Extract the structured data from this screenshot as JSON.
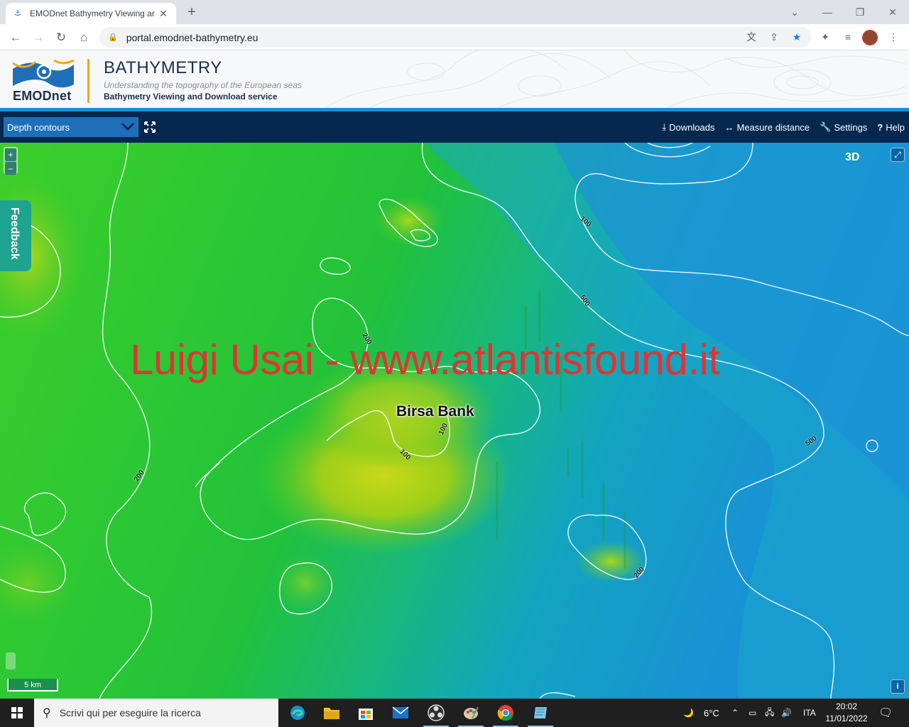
{
  "browser": {
    "tab_title": "EMODnet Bathymetry Viewing ar",
    "url": "portal.emodnet-bathymetry.eu"
  },
  "header": {
    "logo_text": "EMODnet",
    "title": "BATHYMETRY",
    "subtitle": "Understanding the topography of the European seas",
    "service": "Bathymetry Viewing and Download service"
  },
  "nav": {
    "layer_selected": "Depth contours",
    "downloads": "Downloads",
    "measure": "Measure distance",
    "settings": "Settings",
    "help": "Help"
  },
  "map": {
    "feedback": "Feedback",
    "btn_3d": "3D",
    "zoom_in": "+",
    "zoom_out": "–",
    "scale": "5 km",
    "info": "i",
    "watermark": "Luigi Usai - www.atlantisfound.it",
    "place_label": "Birsa Bank",
    "contour_labels": {
      "c1": "100",
      "c2": "500",
      "c3": "200",
      "c4": "100",
      "c5": "100",
      "c6": "500",
      "c7": "200",
      "c8": "200"
    }
  },
  "taskbar": {
    "search_placeholder": "Scrivi qui per eseguire la ricerca",
    "temperature": "6°C",
    "language": "ITA",
    "time": "20:02",
    "date": "11/01/2022"
  },
  "colors": {
    "nav_bg": "#06284f",
    "header_accent": "#1a8ed6",
    "select_bg": "#1f6fb8",
    "feedback_bg": "#1ea38e",
    "watermark": "#e03434"
  }
}
